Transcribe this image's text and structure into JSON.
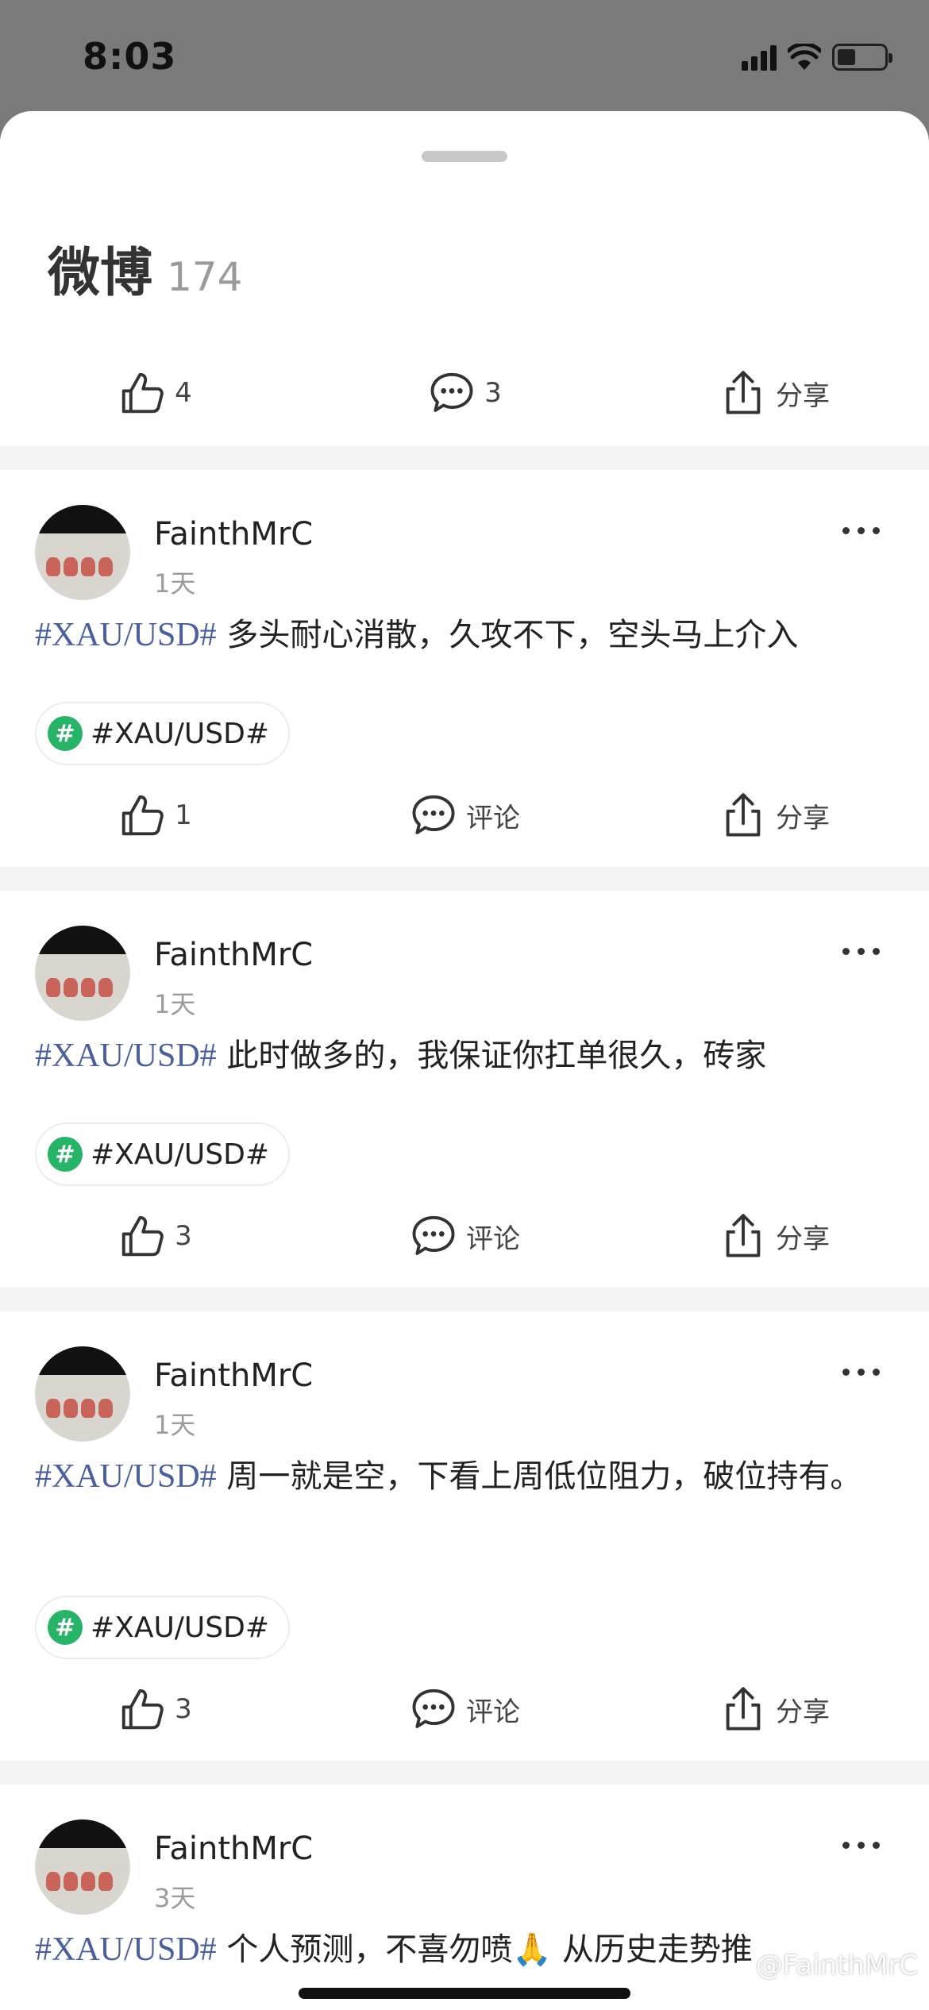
{
  "status_bar": {
    "time": "8:03"
  },
  "sheet": {
    "title": "微博",
    "count": "174",
    "actions": {
      "like_count": "4",
      "comment_count": "3",
      "share_label": "分享"
    }
  },
  "posts": [
    {
      "username": "FainthMrC",
      "time": "1天",
      "hashtag": "#XAU/USD#",
      "text": " 多头耐心消散，久攻不下，空头马上介入",
      "topic": "#XAU/USD#",
      "like_count": "1",
      "comment_label": "评论",
      "share_label": "分享"
    },
    {
      "username": "FainthMrC",
      "time": "1天",
      "hashtag": "#XAU/USD#",
      "text": " 此时做多的，我保证你扛单很久，砖家",
      "topic": "#XAU/USD#",
      "like_count": "3",
      "comment_label": "评论",
      "share_label": "分享"
    },
    {
      "username": "FainthMrC",
      "time": "1天",
      "hashtag": "#XAU/USD#",
      "text": " 周一就是空，下看上周低位阻力，破位持有。",
      "topic": "#XAU/USD#",
      "like_count": "3",
      "comment_label": "评论",
      "share_label": "分享"
    },
    {
      "username": "FainthMrC",
      "time": "3天",
      "hashtag": "#XAU/USD#",
      "text": " 个人预测，不喜勿喷🙏 从历史走势推",
      "topic": "",
      "like_count": "",
      "comment_label": "",
      "share_label": ""
    }
  ],
  "watermark": "@FainthMrC"
}
